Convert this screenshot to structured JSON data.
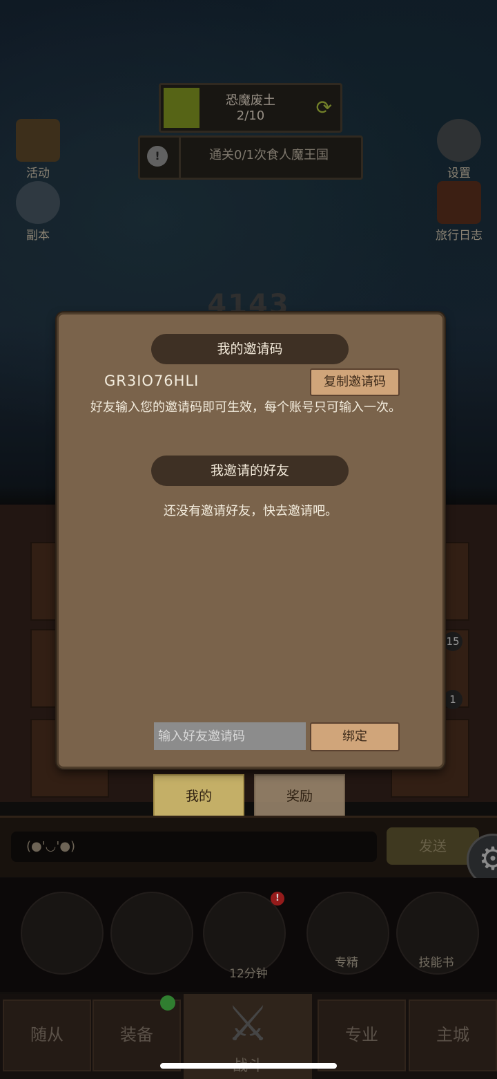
{
  "hud": {
    "stage_name": "恐魔废土",
    "stage_progress": "2/10",
    "quest_text": "通关0/1次食人魔王国",
    "score": "4143"
  },
  "side": {
    "activity": "活动",
    "dungeon": "副本",
    "settings": "设置",
    "journal": "旅行日志"
  },
  "lower": {
    "badge_15": "15",
    "badge_1": "1"
  },
  "popup": {
    "my_code_title": "我的邀请码",
    "invite_code": "GR3IO76HLI",
    "copy_button": "复制邀请码",
    "hint": "好友输入您的邀请码即可生效，每个账号只可输入一次。",
    "my_friends_title": "我邀请的好友",
    "no_friends": "还没有邀请好友，快去邀请吧。",
    "input_placeholder": "输入好友邀请码",
    "bind_button": "绑定"
  },
  "tabs": {
    "mine": "我的",
    "reward": "奖励"
  },
  "chat": {
    "input_text": "(●'◡'●)",
    "send": "发送"
  },
  "quick": {
    "chest_time": "12分钟",
    "mastery": "专精",
    "skill_book": "技能书"
  },
  "nav": {
    "followers": "随从",
    "equipment": "装备",
    "battle": "战斗",
    "profession": "专业",
    "main_city": "主城"
  }
}
